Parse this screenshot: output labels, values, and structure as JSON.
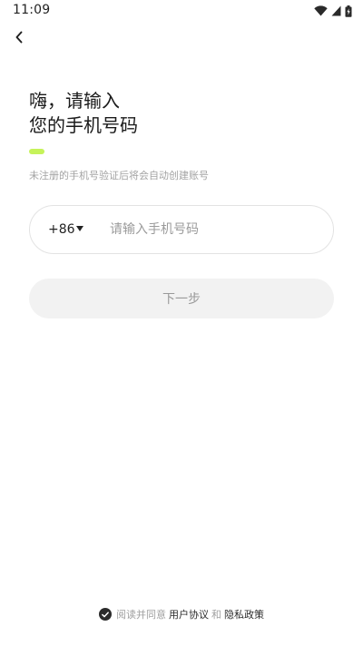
{
  "status_bar": {
    "time": "11:09",
    "icons": [
      "wifi-icon",
      "signal-icon",
      "battery-icon"
    ]
  },
  "header": {
    "back_icon": "chevron-left-icon"
  },
  "heading": {
    "line1": "嗨，请输入",
    "line2": "您的手机号码"
  },
  "accent_color": "#c6f35a",
  "hint": "未注册的手机号验证后将会自动创建账号",
  "phone": {
    "country_code": "+86",
    "placeholder": "请输入手机号码",
    "value": ""
  },
  "next_button": {
    "label": "下一步",
    "state": "disabled"
  },
  "agreement": {
    "checked": true,
    "prefix": "阅读并同意",
    "user_agreement": "用户协议",
    "and": "和",
    "privacy_policy": "隐私政策"
  }
}
